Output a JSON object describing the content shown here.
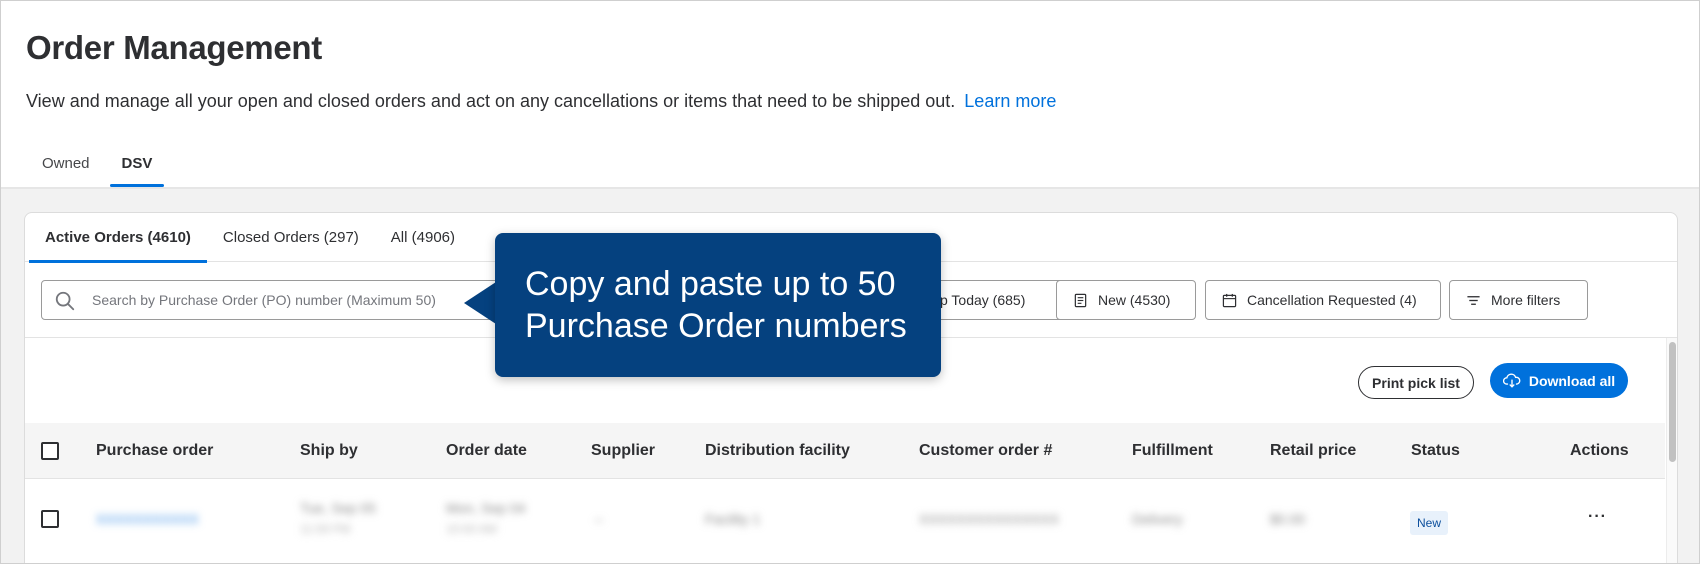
{
  "header": {
    "title": "Order Management",
    "subtitle": "View and manage all your open and closed orders and act on any cancellations or items that need to be shipped out.",
    "learn_more": "Learn more",
    "tabs": [
      {
        "label": "Owned",
        "active": false
      },
      {
        "label": "DSV",
        "active": true
      }
    ]
  },
  "order_tabs": [
    {
      "label": "Active Orders (4610)",
      "active": true
    },
    {
      "label": "Closed Orders (297)",
      "active": false
    },
    {
      "label": "All (4906)",
      "active": false
    }
  ],
  "search": {
    "placeholder": "Search by Purchase Order (PO) number (Maximum 50)"
  },
  "filters": {
    "ship_today": "p Today (685)",
    "new": "New (4530)",
    "cancellation": "Cancellation Requested (4)",
    "more": "More filters"
  },
  "actions": {
    "print": "Print pick list",
    "download": "Download all"
  },
  "table": {
    "columns": [
      "Purchase order",
      "Ship by",
      "Order date",
      "Supplier",
      "Distribution facility",
      "Customer order #",
      "Fulfillment",
      "Retail price",
      "Status",
      "Actions"
    ],
    "rows": [
      {
        "purchase_order": "XXXXXXXXXXX",
        "ship_by": "Tue, Sep 05",
        "ship_by_sub": "11:59 PM",
        "order_date": "Mon, Sep 04",
        "order_date_sub": "10:00 AM",
        "supplier": "–",
        "distribution_facility": "Facility 1",
        "customer_order": "XXXXXXXXXXXXXXX",
        "fulfillment": "Delivery",
        "retail_price": "$0.00",
        "status": "New",
        "actions": "···"
      }
    ]
  },
  "tooltip": {
    "text": "Copy and paste up to 50 Purchase Order numbers"
  },
  "colors": {
    "accent": "#0071dc",
    "tooltip_bg": "#05417f",
    "status_bg": "#e8f1fb"
  }
}
